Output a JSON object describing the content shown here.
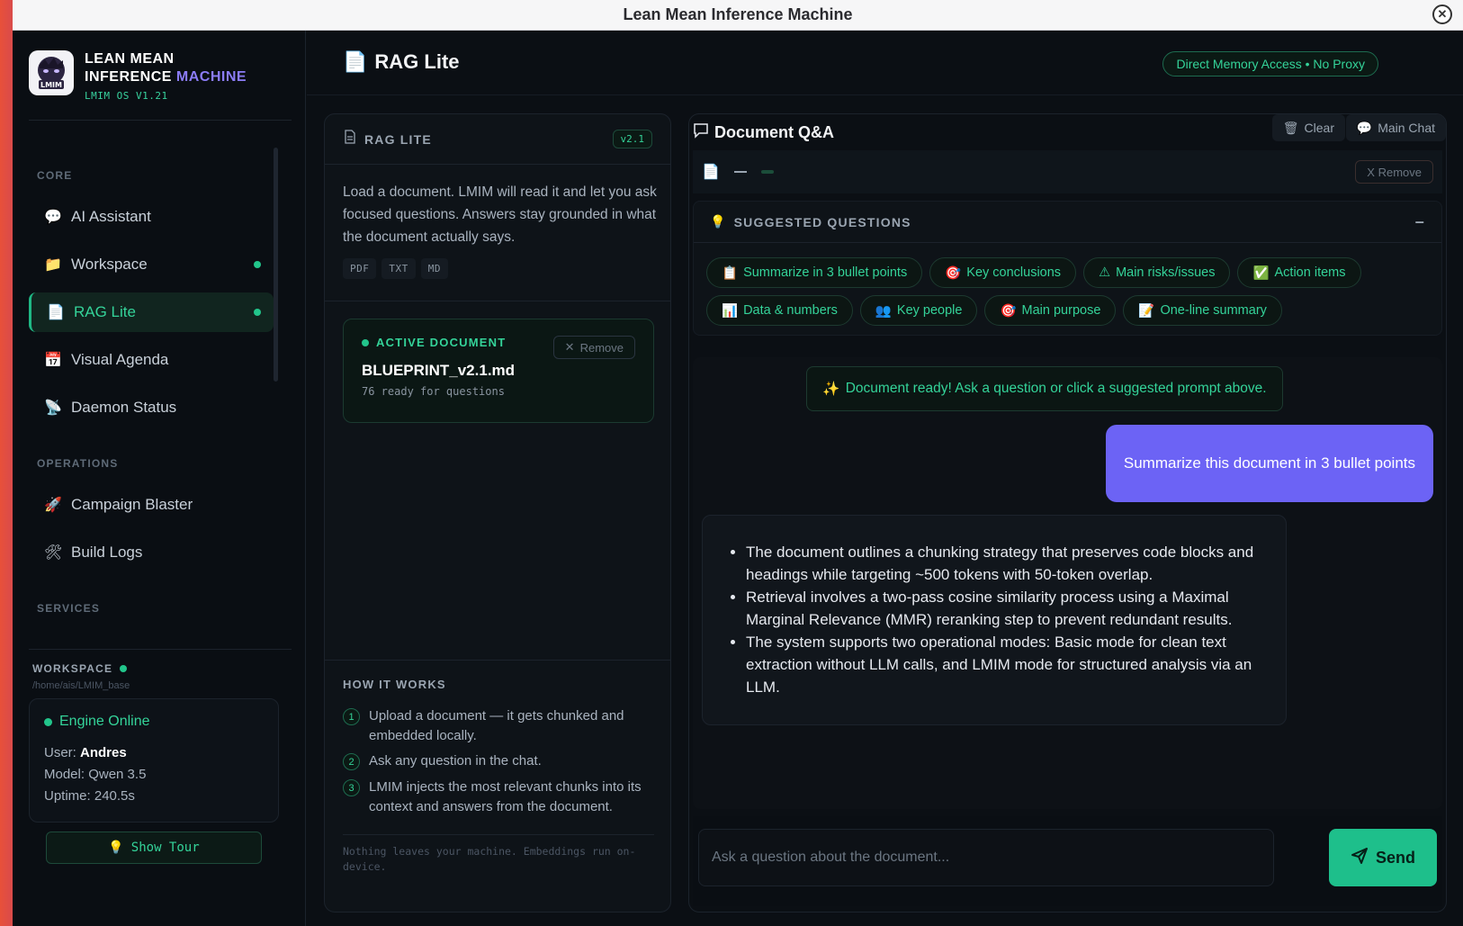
{
  "window": {
    "title": "Lean Mean Inference Machine",
    "close_icon": "close-icon"
  },
  "brand": {
    "line1": "LEAN MEAN",
    "line2_a": "INFERENCE",
    "line2_b": "MACHINE",
    "logo_text": "LMIM",
    "version": "LMIM OS V1.21",
    "accent_color": "#8b7cf6"
  },
  "sidebar": {
    "sections": {
      "core": "CORE",
      "operations": "OPERATIONS",
      "services": "SERVICES"
    },
    "core_items": [
      {
        "label": "AI Assistant",
        "icon": "speech-bubble-icon"
      },
      {
        "label": "Workspace",
        "icon": "folder-icon",
        "status_dot": true
      },
      {
        "label": "RAG Lite",
        "icon": "document-icon",
        "status_dot": true,
        "active": true
      },
      {
        "label": "Visual Agenda",
        "icon": "calendar-icon"
      },
      {
        "label": "Daemon Status",
        "icon": "satellite-icon"
      }
    ],
    "operations_items": [
      {
        "label": "Campaign Blaster",
        "icon": "rocket-icon"
      },
      {
        "label": "Build Logs",
        "icon": "tools-icon"
      }
    ],
    "workspace": {
      "label": "WORKSPACE",
      "path": "/home/ais/LMIM_base",
      "engine_status": "Engine Online",
      "user_label": "User:",
      "user": "Andres",
      "model_label": "Model:",
      "model": "Qwen 3.5",
      "uptime_label": "Uptime:",
      "uptime": "240.5s"
    },
    "tour_button": "Show Tour"
  },
  "header": {
    "title": "RAG Lite",
    "badge": "Direct Memory Access • No Proxy"
  },
  "rag_panel": {
    "title": "RAG LITE",
    "version": "v2.1",
    "description": "Load a document. LMIM will read it and let you ask focused questions. Answers stay grounded in what the document actually says.",
    "formats": [
      "PDF",
      "TXT",
      "MD"
    ],
    "active_document": {
      "label": "ACTIVE DOCUMENT",
      "name": "BLUEPRINT_v2.1.md",
      "status": "76 ready for questions",
      "remove_label": "Remove"
    },
    "how_it_works": {
      "title": "HOW IT WORKS",
      "steps": [
        "Upload a document — it gets chunked and embedded locally.",
        "Ask any question in the chat.",
        "LMIM injects the most relevant chunks into its context and answers from the document."
      ],
      "footnote": "Nothing leaves your machine. Embeddings run on-device."
    }
  },
  "qa": {
    "title": "Document Q&A",
    "clear_label": "Clear",
    "main_chat_label": "Main Chat",
    "doc_strip_remove": "X Remove",
    "suggested": {
      "title": "SUGGESTED QUESTIONS",
      "chips": [
        {
          "emoji": "📋",
          "label": "Summarize in 3 bullet points"
        },
        {
          "emoji": "🎯",
          "label": "Key conclusions"
        },
        {
          "emoji": "⚠",
          "label": "Main risks/issues"
        },
        {
          "emoji": "✅",
          "label": "Action items"
        },
        {
          "emoji": "📊",
          "label": "Data & numbers"
        },
        {
          "emoji": "👥",
          "label": "Key people"
        },
        {
          "emoji": "🎯",
          "label": "Main purpose"
        },
        {
          "emoji": "📝",
          "label": "One-line summary"
        }
      ]
    },
    "ready_note": "Document ready! Ask a question or click a suggested prompt above.",
    "user_message": "Summarize this document in 3 bullet points",
    "bot_bullets": [
      "The document outlines a chunking strategy that preserves code blocks and headings while targeting ~500 tokens with 50-token overlap.",
      "Retrieval involves a two-pass cosine similarity process using a Maximal Marginal Relevance (MMR) reranking step to prevent redundant results.",
      "The system supports two operational modes: Basic mode for clean text extraction without LLM calls, and LMIM mode for structured analysis via an LLM."
    ],
    "input_placeholder": "Ask a question about the document...",
    "send_label": "Send"
  },
  "colors": {
    "accent_green": "#34d399",
    "user_bubble": "#6c63f5",
    "send_button": "#1ebf8b"
  }
}
